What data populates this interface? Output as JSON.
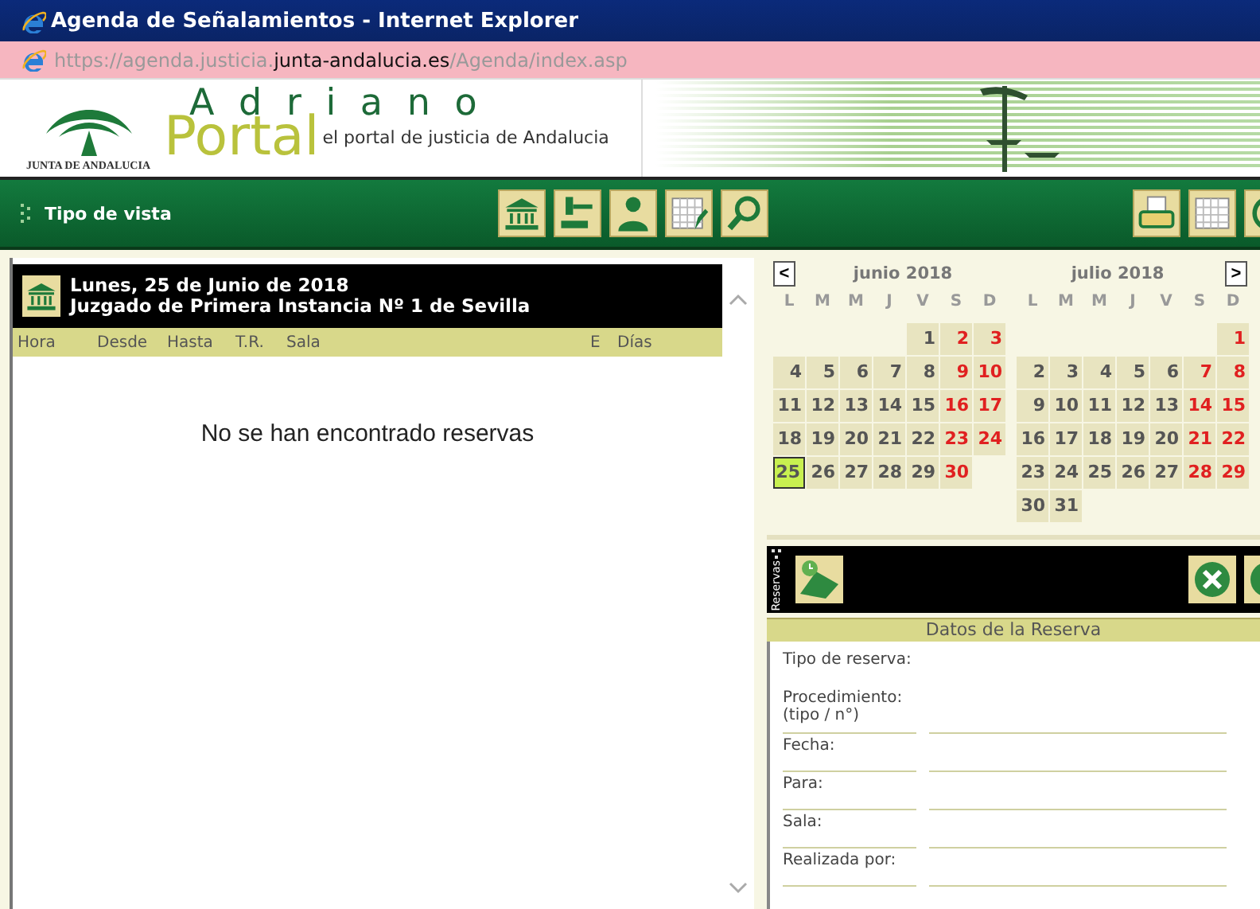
{
  "window": {
    "title": "Agenda de Señalamientos - Internet Explorer"
  },
  "address_bar": {
    "url_parts": [
      {
        "text": "https://agenda.justicia.",
        "kind": "dim"
      },
      {
        "text": "junta-andalucia.es",
        "kind": "domain"
      },
      {
        "text": "/Agenda/index.asp",
        "kind": "dim"
      }
    ]
  },
  "banner": {
    "org": "JUNTA DE ANDALUCIA",
    "app_name": "A d r i a n o",
    "portal": "Portal",
    "tagline": "el portal de justicia de Andalucia"
  },
  "toolbar": {
    "label": "Tipo de vista",
    "tools": [
      {
        "kind": "building"
      },
      {
        "kind": "gavel"
      },
      {
        "kind": "person"
      },
      {
        "kind": "calendar-edit"
      },
      {
        "kind": "search"
      }
    ],
    "right_tools": [
      {
        "kind": "printer"
      },
      {
        "kind": "calendar"
      },
      {
        "kind": "power"
      }
    ]
  },
  "agenda": {
    "date": "Lunes, 25 de Junio de 2018",
    "court": "Juzgado de Primera Instancia Nº 1 de Sevilla",
    "columns": [
      "Hora",
      "Desde",
      "Hasta",
      "T.R.",
      "Sala",
      "E",
      "Días"
    ],
    "empty_message": "No se han encontrado reservas"
  },
  "calendar": {
    "prev": "<",
    "next": ">",
    "months": [
      {
        "title": "junio 2018",
        "weekdays": [
          "L",
          "M",
          "M",
          "J",
          "V",
          "S",
          "D"
        ],
        "weeks": [
          [
            {
              "kind": "blank"
            },
            {
              "kind": "blank"
            },
            {
              "kind": "blank"
            },
            {
              "kind": "blank"
            },
            {
              "kind": "day",
              "day": "1",
              "selected": false
            },
            {
              "kind": "day",
              "day": "2",
              "selected": false
            },
            {
              "kind": "day",
              "day": "3",
              "selected": false
            }
          ],
          [
            {
              "kind": "day",
              "day": "4",
              "selected": false
            },
            {
              "kind": "day",
              "day": "5",
              "selected": false
            },
            {
              "kind": "day",
              "day": "6",
              "selected": false
            },
            {
              "kind": "day",
              "day": "7",
              "selected": false
            },
            {
              "kind": "day",
              "day": "8",
              "selected": false
            },
            {
              "kind": "day",
              "day": "9",
              "selected": false
            },
            {
              "kind": "day",
              "day": "10",
              "selected": false
            }
          ],
          [
            {
              "kind": "day",
              "day": "11",
              "selected": false
            },
            {
              "kind": "day",
              "day": "12",
              "selected": false
            },
            {
              "kind": "day",
              "day": "13",
              "selected": false
            },
            {
              "kind": "day",
              "day": "14",
              "selected": false
            },
            {
              "kind": "day",
              "day": "15",
              "selected": false
            },
            {
              "kind": "day",
              "day": "16",
              "selected": false
            },
            {
              "kind": "day",
              "day": "17",
              "selected": false
            }
          ],
          [
            {
              "kind": "day",
              "day": "18",
              "selected": false
            },
            {
              "kind": "day",
              "day": "19",
              "selected": false
            },
            {
              "kind": "day",
              "day": "20",
              "selected": false
            },
            {
              "kind": "day",
              "day": "21",
              "selected": false
            },
            {
              "kind": "day",
              "day": "22",
              "selected": false
            },
            {
              "kind": "day",
              "day": "23",
              "selected": false
            },
            {
              "kind": "day",
              "day": "24",
              "selected": false
            }
          ],
          [
            {
              "kind": "day",
              "day": "25",
              "selected": true
            },
            {
              "kind": "day",
              "day": "26",
              "selected": false
            },
            {
              "kind": "day",
              "day": "27",
              "selected": false
            },
            {
              "kind": "day",
              "day": "28",
              "selected": false
            },
            {
              "kind": "day",
              "day": "29",
              "selected": false
            },
            {
              "kind": "day",
              "day": "30",
              "selected": false
            },
            {
              "kind": "blank"
            }
          ]
        ]
      },
      {
        "title": "julio 2018",
        "weekdays": [
          "L",
          "M",
          "M",
          "J",
          "V",
          "S",
          "D"
        ],
        "weeks": [
          [
            {
              "kind": "blank"
            },
            {
              "kind": "blank"
            },
            {
              "kind": "blank"
            },
            {
              "kind": "blank"
            },
            {
              "kind": "blank"
            },
            {
              "kind": "blank"
            },
            {
              "kind": "day",
              "day": "1",
              "selected": false
            }
          ],
          [
            {
              "kind": "day",
              "day": "2",
              "selected": false
            },
            {
              "kind": "day",
              "day": "3",
              "selected": false
            },
            {
              "kind": "day",
              "day": "4",
              "selected": false
            },
            {
              "kind": "day",
              "day": "5",
              "selected": false
            },
            {
              "kind": "day",
              "day": "6",
              "selected": false
            },
            {
              "kind": "day",
              "day": "7",
              "selected": false
            },
            {
              "kind": "day",
              "day": "8",
              "selected": false
            }
          ],
          [
            {
              "kind": "day",
              "day": "9",
              "selected": false
            },
            {
              "kind": "day",
              "day": "10",
              "selected": false
            },
            {
              "kind": "day",
              "day": "11",
              "selected": false
            },
            {
              "kind": "day",
              "day": "12",
              "selected": false
            },
            {
              "kind": "day",
              "day": "13",
              "selected": false
            },
            {
              "kind": "day",
              "day": "14",
              "selected": false
            },
            {
              "kind": "day",
              "day": "15",
              "selected": false
            }
          ],
          [
            {
              "kind": "day",
              "day": "16",
              "selected": false
            },
            {
              "kind": "day",
              "day": "17",
              "selected": false
            },
            {
              "kind": "day",
              "day": "18",
              "selected": false
            },
            {
              "kind": "day",
              "day": "19",
              "selected": false
            },
            {
              "kind": "day",
              "day": "20",
              "selected": false
            },
            {
              "kind": "day",
              "day": "21",
              "selected": false
            },
            {
              "kind": "day",
              "day": "22",
              "selected": false
            }
          ],
          [
            {
              "kind": "day",
              "day": "23",
              "selected": false
            },
            {
              "kind": "day",
              "day": "24",
              "selected": false
            },
            {
              "kind": "day",
              "day": "25",
              "selected": false
            },
            {
              "kind": "day",
              "day": "26",
              "selected": false
            },
            {
              "kind": "day",
              "day": "27",
              "selected": false
            },
            {
              "kind": "day",
              "day": "28",
              "selected": false
            },
            {
              "kind": "day",
              "day": "29",
              "selected": false
            }
          ],
          [
            {
              "kind": "day",
              "day": "30",
              "selected": false
            },
            {
              "kind": "day",
              "day": "31",
              "selected": false
            },
            {
              "kind": "blank"
            },
            {
              "kind": "blank"
            },
            {
              "kind": "blank"
            },
            {
              "kind": "blank"
            },
            {
              "kind": "blank"
            }
          ]
        ]
      }
    ]
  },
  "reservas": {
    "label": "Reservas",
    "tools": [
      {
        "kind": "ticket"
      }
    ],
    "right_tools": [
      {
        "kind": "cancel"
      },
      {
        "kind": "save"
      }
    ],
    "header": "Datos de la Reserva",
    "fields": [
      {
        "label": "Tipo de reserva:",
        "kind": "plain"
      },
      {
        "label": "Procedimiento:",
        "note": "(tipo / n°)",
        "kind": "lined"
      },
      {
        "label": "Fecha:",
        "kind": "lined"
      },
      {
        "label": "Para:",
        "kind": "lined"
      },
      {
        "label": "Sala:",
        "kind": "lined"
      },
      {
        "label": "Realizada por:",
        "kind": "lined"
      }
    ]
  }
}
